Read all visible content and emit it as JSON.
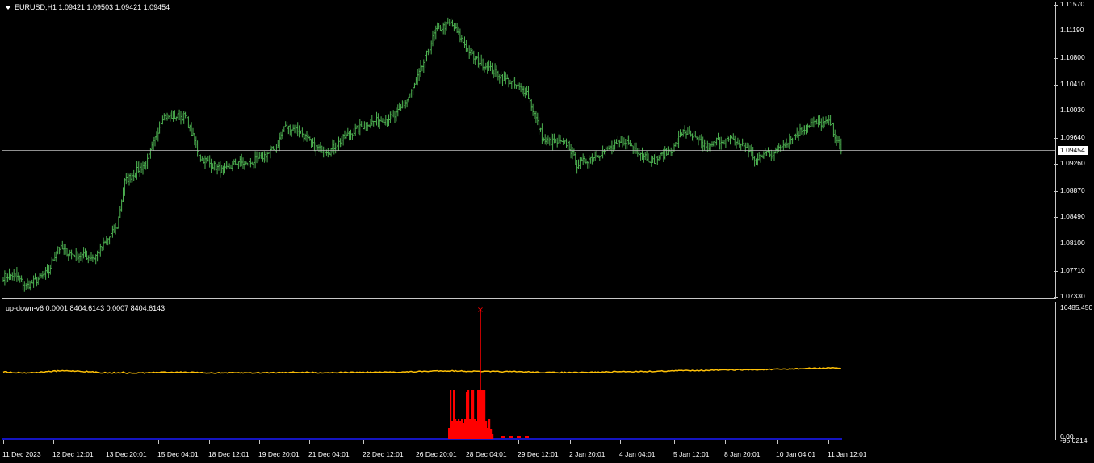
{
  "main_chart": {
    "header": "EURUSD,H1  1.09421 1.09503 1.09421 1.09454",
    "y_labels": [
      "1.11570",
      "1.11190",
      "1.10800",
      "1.10410",
      "1.10030",
      "1.09640",
      "1.09260",
      "1.08870",
      "1.08490",
      "1.08100",
      "1.07710",
      "1.07330"
    ],
    "current_price": "1.09454",
    "bar_color": "#4caf50",
    "price_line_color": "#c0c0c0",
    "ylim": [
      1.0733,
      1.1157
    ]
  },
  "indicator": {
    "header": "up-down-v6 0.0001 8404.6143 0.0007 8404.6143",
    "y_top": "16485.450",
    "y_bottom_a": "0.00",
    "y_bottom_b": "-95.0214",
    "line_color": "#ffc107",
    "hist_color": "#ff0000",
    "base_color": "#1a1aff"
  },
  "x_labels": [
    "11 Dec 2023",
    "12 Dec 12:01",
    "13 Dec 20:01",
    "15 Dec 04:01",
    "18 Dec 12:01",
    "19 Dec 20:01",
    "21 Dec 04:01",
    "22 Dec 12:01",
    "26 Dec 20:01",
    "28 Dec 04:01",
    "29 Dec 12:01",
    "2 Jan 20:01",
    "4 Jan 04:01",
    "5 Jan 12:01",
    "8 Jan 20:01",
    "10 Jan 04:01",
    "11 Jan 12:01"
  ],
  "chart_data": {
    "type": "line",
    "title": "EURUSD,H1",
    "anchors_x_index": [
      0,
      8,
      15,
      24,
      30,
      36,
      45,
      60,
      75,
      80,
      95,
      105,
      120,
      130,
      145,
      155,
      160,
      170,
      180,
      185,
      195,
      205,
      215,
      225,
      240,
      258,
      265,
      270,
      280,
      285,
      295,
      310,
      330,
      345,
      356,
      372,
      378,
      392,
      410,
      412,
      428,
      442,
      448,
      460,
      466,
      470,
      480,
      490,
      496,
      504,
      506,
      520,
      532,
      545,
      552
    ],
    "anchors_price": [
      1.0762,
      1.0765,
      1.0748,
      1.076,
      1.077,
      1.0805,
      1.0795,
      1.079,
      1.0835,
      1.09,
      1.093,
      1.0995,
      1.0995,
      1.0935,
      1.0915,
      1.093,
      1.0925,
      1.0935,
      1.095,
      1.098,
      1.0975,
      1.095,
      1.0945,
      1.0965,
      1.0985,
      1.0995,
      1.1015,
      1.1035,
      1.109,
      1.112,
      1.113,
      1.108,
      1.105,
      1.103,
      1.096,
      1.0955,
      1.0925,
      1.094,
      1.096,
      1.0955,
      1.093,
      1.095,
      1.0975,
      1.0955,
      1.095,
      1.096,
      1.096,
      1.095,
      1.093,
      1.0945,
      1.094,
      1.0965,
      1.0985,
      1.0985,
      1.0945
    ],
    "bar_count": 553
  }
}
